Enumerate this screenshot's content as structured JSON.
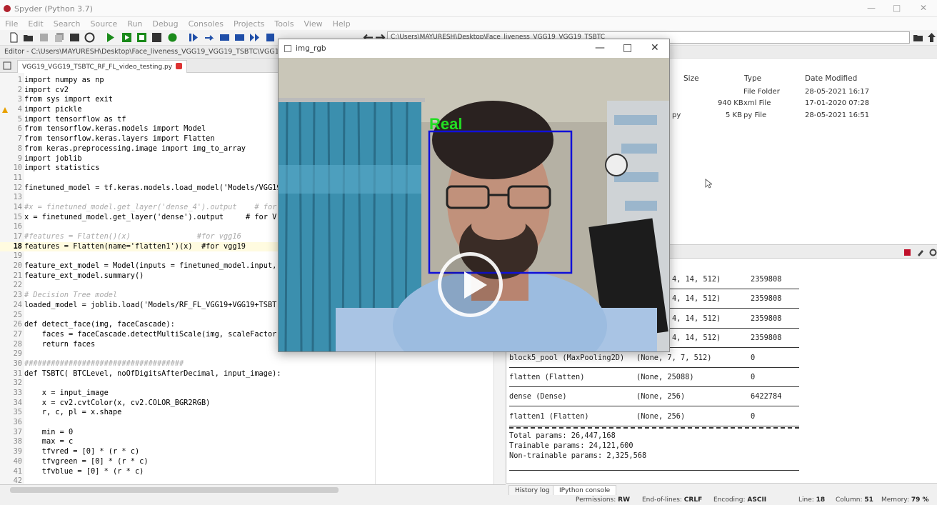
{
  "window": {
    "title": "Spyder (Python 3.7)"
  },
  "menu": [
    "File",
    "Edit",
    "Search",
    "Source",
    "Run",
    "Debug",
    "Consoles",
    "Projects",
    "Tools",
    "View",
    "Help"
  ],
  "toolbar": {
    "path": "C:\\Users\\MAYURESH\\Desktop\\Face_liveness_VGG19_VGG19_TSBTC"
  },
  "editor": {
    "path": "Editor - C:\\Users\\MAYURESH\\Desktop\\Face_liveness_VGG19_VGG19_TSBTC\\VGG19_VGG19_TSBTC",
    "tab": "VGG19_VGG19_TSBTC_RF_FL_video_testing.py",
    "current_line": 18,
    "lines": [
      {
        "n": "1",
        "t": "import numpy as np"
      },
      {
        "n": "2",
        "t": "import cv2"
      },
      {
        "n": "3",
        "t": "from sys import exit"
      },
      {
        "n": "4",
        "t": "import pickle"
      },
      {
        "n": "5",
        "t": "import tensorflow as tf"
      },
      {
        "n": "6",
        "t": "from tensorflow.keras.models import Model"
      },
      {
        "n": "7",
        "t": "from tensorflow.keras.layers import Flatten"
      },
      {
        "n": "8",
        "t": "from keras.preprocessing.image import img_to_array"
      },
      {
        "n": "9",
        "t": "import joblib"
      },
      {
        "n": "10",
        "t": "import statistics"
      },
      {
        "n": "11",
        "t": ""
      },
      {
        "n": "12",
        "t": "finetuned_model = tf.keras.models.load_model('Models/VGG19"
      },
      {
        "n": "13",
        "t": ""
      },
      {
        "n": "14",
        "t": "#x = finetuned_model.get_layer('dense_4').output    # for"
      },
      {
        "n": "15",
        "t": "x = finetuned_model.get_layer('dense').output     # for V"
      },
      {
        "n": "16",
        "t": ""
      },
      {
        "n": "17",
        "t": "#features = Flatten()(x)               #for vgg16"
      },
      {
        "n": "18",
        "t": "features = Flatten(name='flatten1')(x)  #for vgg19"
      },
      {
        "n": "19",
        "t": ""
      },
      {
        "n": "20",
        "t": "feature_ext_model = Model(inputs = finetuned_model.input,"
      },
      {
        "n": "21",
        "t": "feature_ext_model.summary()"
      },
      {
        "n": "22",
        "t": ""
      },
      {
        "n": "23",
        "t": "# Decision Tree model"
      },
      {
        "n": "24",
        "t": "loaded_model = joblib.load('Models/RF_FL_VGG19+VGG19+TSBT"
      },
      {
        "n": "25",
        "t": ""
      },
      {
        "n": "26",
        "t": "def detect_face(img, faceCascade):"
      },
      {
        "n": "27",
        "t": "    faces = faceCascade.detectMultiScale(img, scaleFactor"
      },
      {
        "n": "28",
        "t": "    return faces"
      },
      {
        "n": "29",
        "t": ""
      },
      {
        "n": "30",
        "t": "####################################"
      },
      {
        "n": "31",
        "t": "def TSBTC( BTCLevel, noOfDigitsAfterDecimal, input_image):"
      },
      {
        "n": "32",
        "t": ""
      },
      {
        "n": "33",
        "t": "    x = input_image"
      },
      {
        "n": "34",
        "t": "    x = cv2.cvtColor(x, cv2.COLOR_BGR2RGB)"
      },
      {
        "n": "35",
        "t": "    r, c, pl = x.shape"
      },
      {
        "n": "36",
        "t": ""
      },
      {
        "n": "37",
        "t": "    min = 0"
      },
      {
        "n": "38",
        "t": "    max = c"
      },
      {
        "n": "39",
        "t": "    tfvred = [0] * (r * c)"
      },
      {
        "n": "40",
        "t": "    tfvgreen = [0] * (r * c)"
      },
      {
        "n": "41",
        "t": "    tfvblue = [0] * (r * c)"
      },
      {
        "n": "42",
        "t": ""
      }
    ]
  },
  "files": {
    "headers": [
      "Size",
      "Type",
      "Date Modified"
    ],
    "rows": [
      {
        "name": "",
        "size": "",
        "type": "File Folder",
        "date": "28-05-2021 16:17"
      },
      {
        "name": "",
        "size": "940 KB",
        "type": "xml File",
        "date": "17-01-2020 07:28"
      },
      {
        "name": "py",
        "size": "5 KB",
        "type": "py File",
        "date": "28-05-2021 16:51"
      }
    ]
  },
  "console": {
    "rows": [
      {
        "layer": "",
        "shape": "4, 14, 512)",
        "params": "2359808"
      },
      {
        "layer": "",
        "shape": "4, 14, 512)",
        "params": "2359808"
      },
      {
        "layer": "",
        "shape": "4, 14, 512)",
        "params": "2359808"
      },
      {
        "layer": "",
        "shape": "4, 14, 512)",
        "params": "2359808"
      },
      {
        "layer": "block5_pool (MaxPooling2D)",
        "shape": "(None, 7, 7, 512)",
        "params": "0"
      },
      {
        "layer": "flatten (Flatten)",
        "shape": "(None, 25088)",
        "params": "0"
      },
      {
        "layer": "dense (Dense)",
        "shape": "(None, 256)",
        "params": "6422784"
      },
      {
        "layer": "flatten1 (Flatten)",
        "shape": "(None, 256)",
        "params": "0"
      }
    ],
    "total": "Total params: 26,447,168",
    "trainable": "Trainable params: 24,121,600",
    "non_trainable": "Non-trainable params: 2,325,568",
    "tabs": [
      "History log",
      "IPython console"
    ]
  },
  "camera": {
    "title": "img_rgb",
    "label": "Real",
    "label_color": "#22dd22",
    "box_color": "#1010d8"
  },
  "status": {
    "permissions_label": "Permissions:",
    "permissions": "RW",
    "eol_label": "End-of-lines:",
    "eol": "CRLF",
    "encoding_label": "Encoding:",
    "encoding": "ASCII",
    "line_label": "Line:",
    "line": "18",
    "column_label": "Column:",
    "column": "51",
    "memory_label": "Memory:",
    "memory": "79 %"
  }
}
